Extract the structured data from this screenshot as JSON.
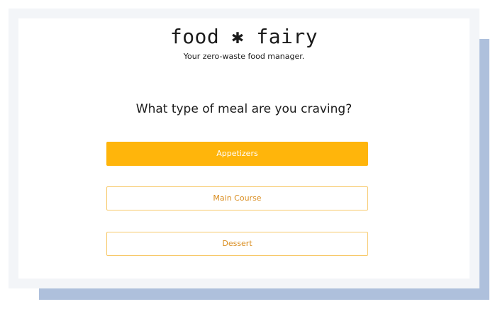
{
  "brand": {
    "logo_text": "food ✱ fairy",
    "tagline": "Your zero-waste food manager."
  },
  "quiz": {
    "question": "What type of meal are you craving?",
    "options": [
      {
        "label": "Appetizers",
        "state": "selected"
      },
      {
        "label": "Main Course",
        "state": "default"
      },
      {
        "label": "Dessert",
        "state": "default"
      }
    ]
  },
  "colors": {
    "accent": "#ffb50b",
    "outline_border": "#f7c96a",
    "outline_text": "#d98c1d",
    "shadow": "#aec0dc",
    "frame": "#f3f5f8"
  }
}
